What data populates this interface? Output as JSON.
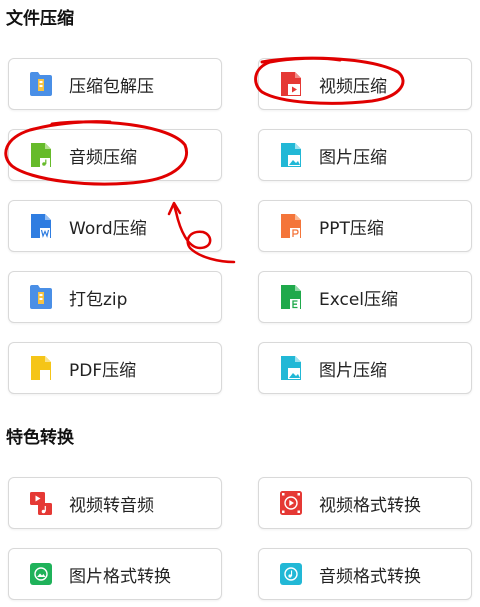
{
  "sections": [
    {
      "title": "文件压缩",
      "items": [
        {
          "label": "压缩包解压",
          "icon": "zip-folder-icon",
          "color": "#4a8fe6"
        },
        {
          "label": "视频压缩",
          "icon": "video-file-icon",
          "color": "#e53935"
        },
        {
          "label": "音频压缩",
          "icon": "audio-file-icon",
          "color": "#66bb2a"
        },
        {
          "label": "图片压缩",
          "icon": "image-file-icon",
          "color": "#22b8d6"
        },
        {
          "label": "Word压缩",
          "icon": "word-file-icon",
          "color": "#2f7de1"
        },
        {
          "label": "PPT压缩",
          "icon": "ppt-file-icon",
          "color": "#f4753a"
        },
        {
          "label": "打包zip",
          "icon": "zip-folder-icon",
          "color": "#4a8fe6"
        },
        {
          "label": "Excel压缩",
          "icon": "excel-file-icon",
          "color": "#1fa94b"
        },
        {
          "label": "PDF压缩",
          "icon": "pdf-file-icon",
          "color": "#f5c518"
        },
        {
          "label": "图片压缩",
          "icon": "image-file-icon",
          "color": "#22b8d6"
        }
      ]
    },
    {
      "title": "特色转换",
      "items": [
        {
          "label": "视频转音频",
          "icon": "video-to-audio-icon",
          "color": "#e53935"
        },
        {
          "label": "视频格式转换",
          "icon": "video-format-icon",
          "color": "#e53935"
        },
        {
          "label": "图片格式转换",
          "icon": "image-format-icon",
          "color": "#1fb25a"
        },
        {
          "label": "音频格式转换",
          "icon": "audio-format-icon",
          "color": "#22b8d6"
        }
      ]
    }
  ],
  "annotations": {
    "stroke_color": "#e00000"
  }
}
